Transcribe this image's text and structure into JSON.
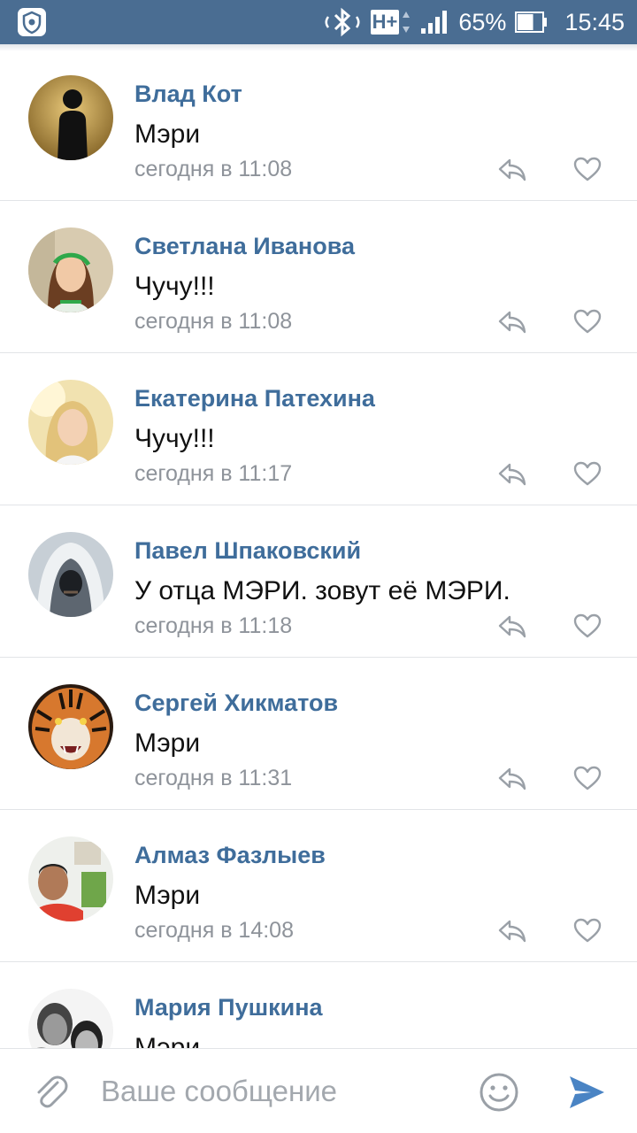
{
  "status_bar": {
    "app_icon": "shield-app-icon",
    "network": "H+",
    "battery": "65%",
    "battery_level": 0.65,
    "time": "15:45"
  },
  "comments": [
    {
      "name": "Влад Кот",
      "text": "Мэри",
      "time": "сегодня в 11:08"
    },
    {
      "name": "Светлана Иванова",
      "text": "Чучу!!!",
      "time": "сегодня в 11:08"
    },
    {
      "name": "Екатерина Патехина",
      "text": "Чучу!!!",
      "time": "сегодня в 11:17"
    },
    {
      "name": "Павел Шпаковский",
      "text": "У отца МЭРИ. зовут её МЭРИ.",
      "time": "сегодня в 11:18"
    },
    {
      "name": "Сергей Хикматов",
      "text": "Мэри",
      "time": "сегодня в 11:31"
    },
    {
      "name": "Алмаз Фазлыев",
      "text": "Мэри",
      "time": "сегодня в 14:08"
    },
    {
      "name": "Мария Пушкина",
      "text": "Мэри",
      "time": ""
    }
  ],
  "composer": {
    "placeholder": "Ваше сообщение",
    "icons": [
      "paperclip-icon",
      "smiley-icon",
      "send-icon"
    ]
  },
  "colors": {
    "status_bar": "#4a6d92",
    "name": "#3f6d9b",
    "send": "#4a84c4",
    "secondary": "#8e939a"
  }
}
